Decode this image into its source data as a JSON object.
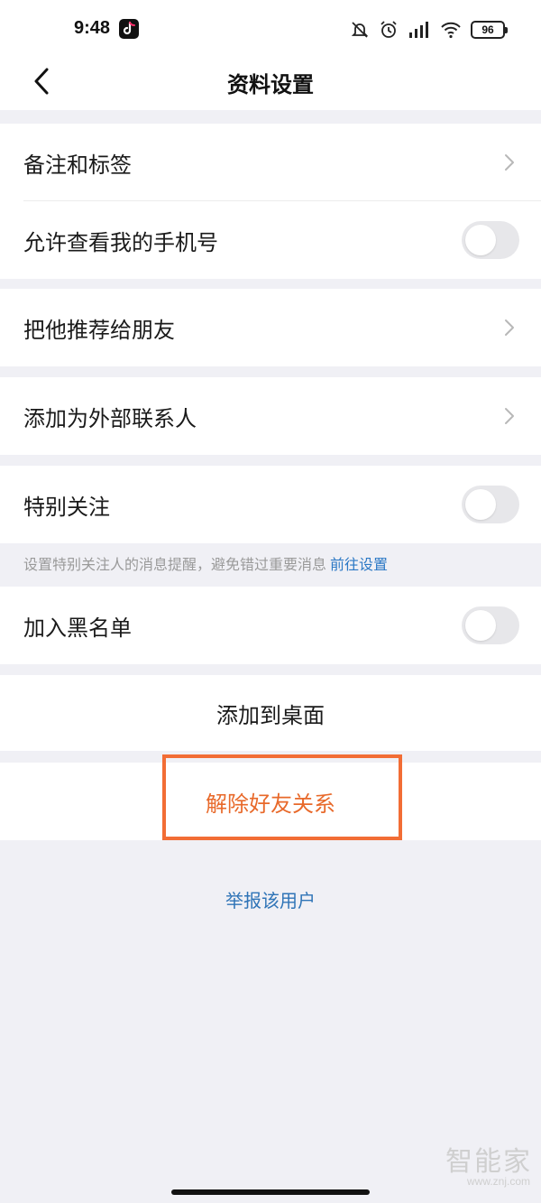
{
  "status_bar": {
    "time": "9:48",
    "battery": "96",
    "icons": [
      "tiktok-icon",
      "mute-icon",
      "alarm-icon",
      "hd-signal-icon",
      "wifi-icon",
      "battery-icon"
    ]
  },
  "nav": {
    "title": "资料设置",
    "back_icon": "chevron-left-icon"
  },
  "rows": {
    "remark_tags": "备注和标签",
    "allow_phone": "允许查看我的手机号",
    "recommend_friend": "把他推荐给朋友",
    "add_external": "添加为外部联系人",
    "special_follow": "特别关注",
    "blacklist": "加入黑名单"
  },
  "toggles": {
    "allow_phone": false,
    "special_follow": false,
    "blacklist": false
  },
  "hint": {
    "text": "设置特别关注人的消息提醒，避免错过重要消息",
    "link": "前往设置"
  },
  "actions": {
    "add_desktop": "添加到桌面",
    "remove_friend": "解除好友关系",
    "report_user": "举报该用户"
  },
  "watermark": {
    "text": "智能家",
    "url": "www.znj.com"
  },
  "colors": {
    "background": "#f0f0f5",
    "danger": "#e8692a",
    "highlight": "#f26d35",
    "link": "#2b78c5"
  }
}
